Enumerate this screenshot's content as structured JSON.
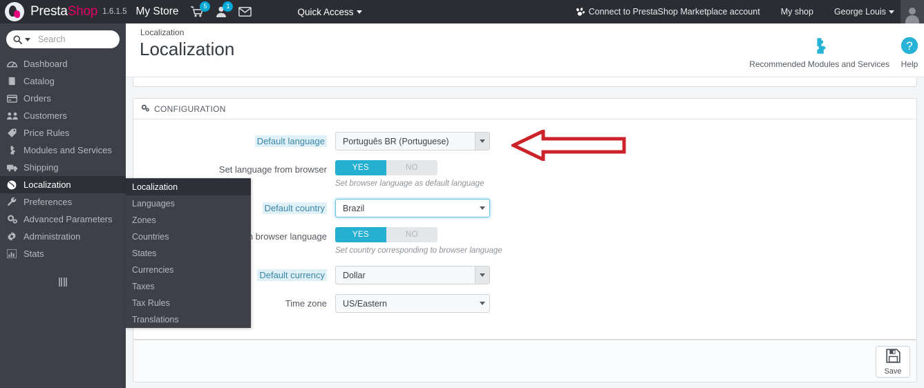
{
  "header": {
    "brand_first": "Presta",
    "brand_second": "Shop",
    "version": "1.6.1.5",
    "shop_name": "My Store",
    "cart_badge": "5",
    "customers_badge": "1",
    "cart_icon": "shopping-cart-icon",
    "customers_icon": "user-icon",
    "messages_icon": "envelope-icon",
    "quick_access": "Quick Access",
    "marketplace": "Connect to PrestaShop Marketplace account",
    "marketplace_icon": "prestashop-paw-icon",
    "my_shop": "My shop",
    "employee": "George Louis",
    "avatar": "employee-avatar",
    "accent_blue": "#00a8d6",
    "brand_pink": "#df0067",
    "bar_color": "#2b2d33"
  },
  "search": {
    "placeholder": "Search",
    "value": "",
    "icon": "magnifier-icon"
  },
  "sidebar": {
    "bg_color": "#3d4049",
    "active_color": "#2e3038",
    "collapse_handle": "collapse-sidebar-handle",
    "items": [
      {
        "label": "Dashboard",
        "icon": "dashboard-icon",
        "active": false
      },
      {
        "label": "Catalog",
        "icon": "book-icon",
        "active": false
      },
      {
        "label": "Orders",
        "icon": "credit-card-icon",
        "active": false
      },
      {
        "label": "Customers",
        "icon": "group-icon",
        "active": false
      },
      {
        "label": "Price Rules",
        "icon": "tag-icon",
        "active": false
      },
      {
        "label": "Modules and Services",
        "icon": "puzzle-icon",
        "active": false
      },
      {
        "label": "Shipping",
        "icon": "truck-icon",
        "active": false
      },
      {
        "label": "Localization",
        "icon": "globe-icon",
        "active": true
      },
      {
        "label": "Preferences",
        "icon": "wrench-icon",
        "active": false
      },
      {
        "label": "Advanced Parameters",
        "icon": "cogs-icon",
        "active": false
      },
      {
        "label": "Administration",
        "icon": "gear-icon",
        "active": false
      },
      {
        "label": "Stats",
        "icon": "bar-chart-icon",
        "active": false
      }
    ]
  },
  "submenu": {
    "items": [
      {
        "label": "Localization",
        "active": true
      },
      {
        "label": "Languages",
        "active": false
      },
      {
        "label": "Zones",
        "active": false
      },
      {
        "label": "Countries",
        "active": false
      },
      {
        "label": "States",
        "active": false
      },
      {
        "label": "Currencies",
        "active": false
      },
      {
        "label": "Taxes",
        "active": false
      },
      {
        "label": "Tax Rules",
        "active": false
      },
      {
        "label": "Translations",
        "active": false
      }
    ]
  },
  "page": {
    "breadcrumb": "Localization",
    "title": "Localization",
    "actions": [
      {
        "label": "Recommended Modules and Services",
        "icon": "puzzle-piece-icon"
      },
      {
        "label": "Help",
        "icon": "question-circle-icon"
      }
    ]
  },
  "panel": {
    "header_title": "CONFIGURATION",
    "header_icon": "cogs-icon",
    "rows": [
      {
        "label": "Default language",
        "highlighted": true,
        "control": "select",
        "value": "Português BR (Portuguese)",
        "focused": false,
        "hint": ""
      },
      {
        "label": "Set language from browser",
        "highlighted": false,
        "control": "switch",
        "yes_label": "YES",
        "no_label": "NO",
        "value": "YES",
        "hint": "Set browser language as default language"
      },
      {
        "label": "Default country",
        "highlighted": true,
        "control": "select",
        "value": "Brazil",
        "focused": true,
        "hint": ""
      },
      {
        "label": "Set country from browser language",
        "highlighted": false,
        "control": "switch",
        "yes_label": "YES",
        "no_label": "NO",
        "value": "YES",
        "hint": "Set country corresponding to browser language"
      },
      {
        "label": "Default currency",
        "highlighted": true,
        "control": "select",
        "value": "Dollar",
        "focused": false,
        "hint": ""
      },
      {
        "label": "Time zone",
        "highlighted": false,
        "control": "select",
        "value": "US/Eastern",
        "focused": false,
        "hint": ""
      }
    ],
    "save_label": "Save",
    "save_icon": "floppy-disk-icon",
    "toggle_on_color": "#25b0d2"
  },
  "annotation": {
    "arrow": "red-left-arrow",
    "color": "#cc2229",
    "points_at": "Default language"
  }
}
